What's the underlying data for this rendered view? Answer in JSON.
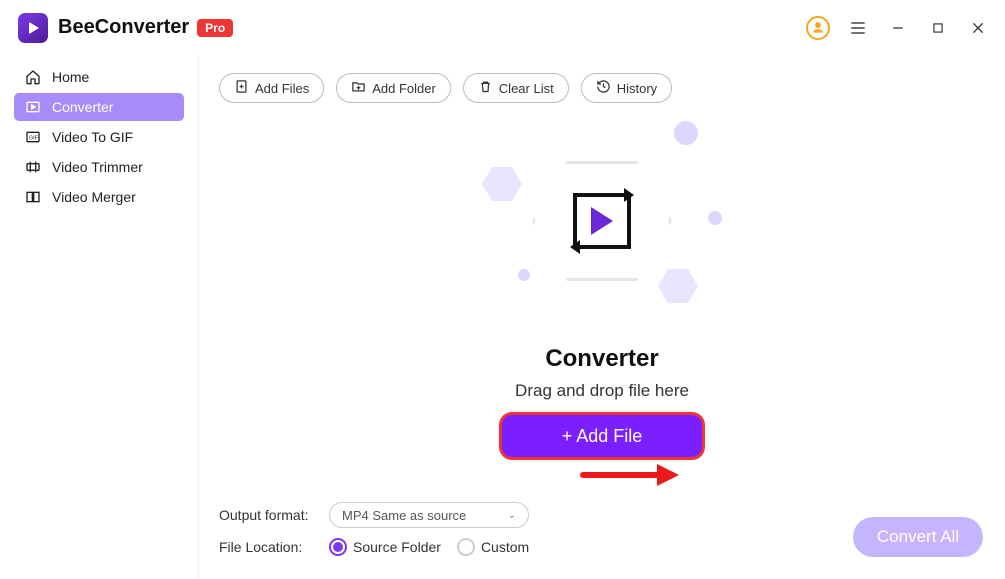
{
  "app": {
    "name": "BeeConverter",
    "badge": "Pro"
  },
  "sidebar": {
    "items": [
      {
        "label": "Home"
      },
      {
        "label": "Converter"
      },
      {
        "label": "Video To GIF"
      },
      {
        "label": "Video Trimmer"
      },
      {
        "label": "Video Merger"
      }
    ]
  },
  "toolbar": {
    "add_files": "Add Files",
    "add_folder": "Add Folder",
    "clear_list": "Clear List",
    "history": "History"
  },
  "center": {
    "title": "Converter",
    "hint": "Drag and drop file here",
    "add_file_btn": "+ Add File"
  },
  "bottom": {
    "output_label": "Output format:",
    "output_value": "MP4 Same as source",
    "location_label": "File Location:",
    "source_folder": "Source Folder",
    "custom": "Custom"
  },
  "actions": {
    "convert_all": "Convert All"
  }
}
